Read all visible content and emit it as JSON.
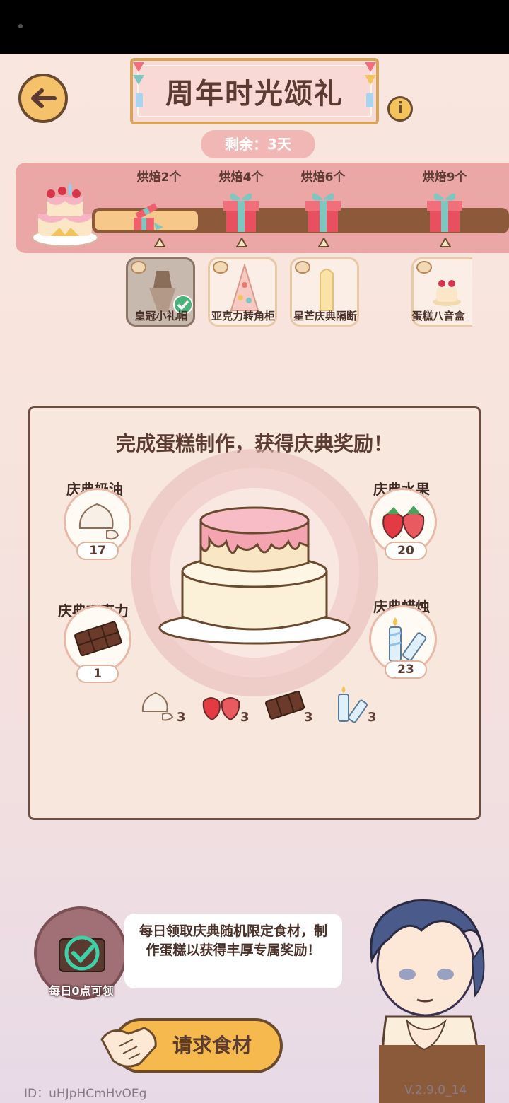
{
  "title": "周年时光颂礼",
  "remaining": "剩余：3天",
  "milestones": [
    {
      "label": "烘焙2个",
      "opened": true
    },
    {
      "label": "烘焙4个",
      "opened": false
    },
    {
      "label": "烘焙6个",
      "opened": false
    },
    {
      "label": "烘焙9个",
      "opened": false
    }
  ],
  "progress_fraction": 0.25,
  "rewards": [
    {
      "name": "皇冠小礼帽",
      "claimed": true
    },
    {
      "name": "亚克力转角柜",
      "claimed": false
    },
    {
      "name": "星芒庆典隔断",
      "claimed": false
    },
    {
      "name": "蛋糕八音盒",
      "claimed": false
    }
  ],
  "panel": {
    "title": "完成蛋糕制作，获得庆典奖励！",
    "ingredients": {
      "cream": {
        "name": "庆典奶油",
        "count": "17"
      },
      "fruit": {
        "name": "庆典水果",
        "count": "20"
      },
      "chocolate": {
        "name": "庆典巧克力",
        "count": "1"
      },
      "candle": {
        "name": "庆典蜡烛",
        "count": "23"
      }
    },
    "requirements": {
      "cream": "3",
      "fruit": "3",
      "chocolate": "3",
      "candle": "3"
    }
  },
  "daily": {
    "label": "每日0点可领",
    "bubble": "每日领取庆典随机限定食材，制作蛋糕以获得丰厚专属奖励！"
  },
  "request_button": "请求食材",
  "footer": {
    "id": "ID：uHJpHCmHvOEg",
    "version": "V.2.9.0_14"
  },
  "colors": {
    "accent": "#f5b94e",
    "band": "#eaa7a6",
    "track": "#8c5a3b"
  }
}
